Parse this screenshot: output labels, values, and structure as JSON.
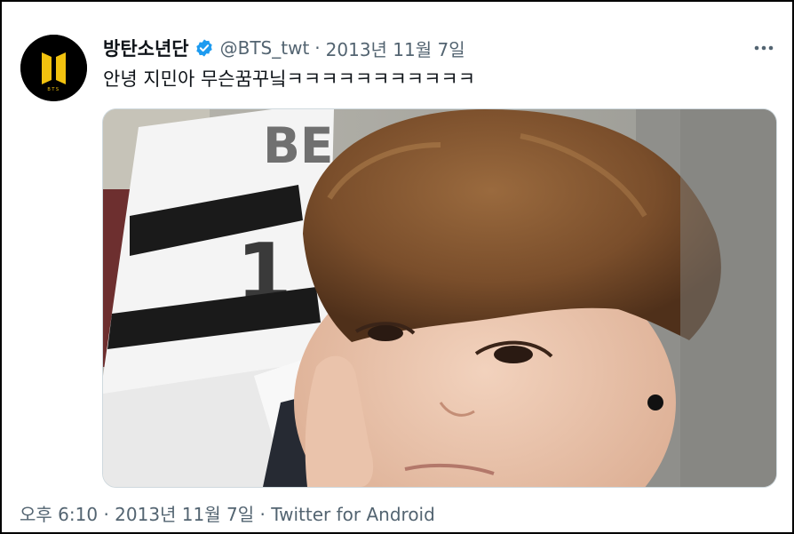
{
  "tweet": {
    "author": {
      "display_name": "방탄소년단",
      "handle": "@BTS_twt",
      "verified": true,
      "avatar_logo_text": "BTS"
    },
    "separator": "·",
    "date_short": "2013년 11월 7일",
    "text": "안녕 지민아 무슨꿈꾸닠ㅋㅋㅋㅋㅋㅋㅋㅋㅋㅋㅋ",
    "footer": {
      "time": "오후 6:10",
      "separator": "·",
      "date": "2013년 11월 7일",
      "source": "Twitter for Android"
    }
  },
  "colors": {
    "text_primary": "#0f1419",
    "text_secondary": "#536471",
    "verified_blue": "#1d9bf0",
    "logo_gold": "#f2c20f"
  },
  "icons": [
    "bts-logo-icon",
    "verified-badge-icon",
    "more-options-icon"
  ]
}
